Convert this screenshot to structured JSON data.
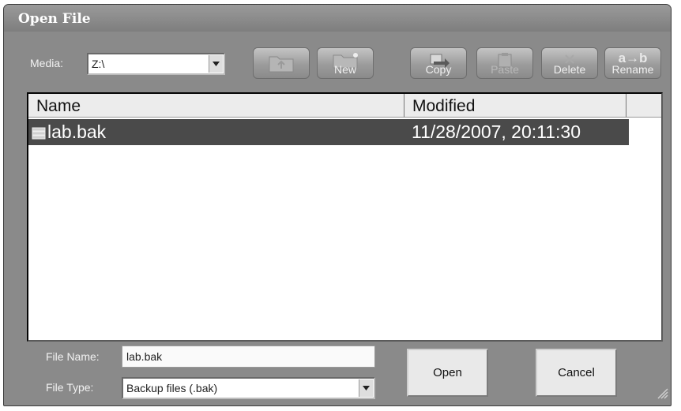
{
  "window": {
    "title": "Open File"
  },
  "media": {
    "label": "Media:",
    "value": "Z:\\"
  },
  "toolbar": {
    "new_label": "New",
    "copy_label": "Copy",
    "paste_label": "Paste",
    "delete_label": "Delete",
    "rename_label": "Rename",
    "rename_glyph": "a→b"
  },
  "file_list": {
    "columns": [
      "Name",
      "Modified"
    ],
    "rows": [
      {
        "name": "lab.bak",
        "modified": "11/28/2007, 20:11:30",
        "selected": true
      }
    ]
  },
  "file_name": {
    "label": "File Name:",
    "value": "lab.bak"
  },
  "file_type": {
    "label": "File Type:",
    "value": "Backup files (.bak)"
  },
  "buttons": {
    "open": "Open",
    "cancel": "Cancel"
  },
  "colors": {
    "selection": "#4a4a4a",
    "dialog_bg": "#8a8a8a"
  }
}
